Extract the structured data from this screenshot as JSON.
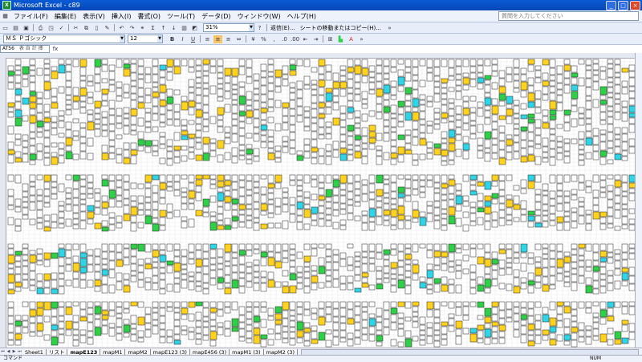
{
  "window": {
    "title": "Microsoft Excel - c89"
  },
  "menu": [
    "ファイル(F)",
    "編集(E)",
    "表示(V)",
    "挿入(I)",
    "書式(O)",
    "ツール(T)",
    "データ(D)",
    "ウィンドウ(W)",
    "ヘルプ(H)"
  ],
  "help_placeholder": "質問を入力してください",
  "toolbar": {
    "zoom": "31%",
    "reply_label": "返信(E)...",
    "sheet_move_label": "シートの移動またはコピー(H)..."
  },
  "format": {
    "font": "ＭＳ Ｐゴシック",
    "size": "12",
    "bold": "B",
    "italic": "I",
    "underline": "U"
  },
  "formula": {
    "name_box": "AT56",
    "name_hint": "表 自 計 挿"
  },
  "sheets": [
    "Sheet1",
    "リスト",
    "mapE123",
    "mapM1",
    "mapM2",
    "mapE123 (3)",
    "mapE456 (3)",
    "mapM1 (3)",
    "mapM2 (3)"
  ],
  "active_sheet": 2,
  "status": {
    "left": "コマンド",
    "right": "NUM"
  },
  "cell_colors": {
    "yellow": "#ffd21e",
    "green": "#2fcf47",
    "cyan": "#2fd5e6",
    "white": "#ffffff"
  }
}
